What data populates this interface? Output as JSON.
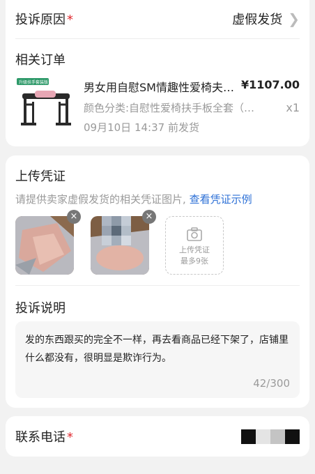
{
  "complaint_reason": {
    "label": "投诉原因",
    "required_mark": "*",
    "value": "虚假发货"
  },
  "related_order": {
    "title": "相关订单",
    "thumb_tag": "升级扶手套装版",
    "product_title": "男女用自慰SM情趣性爱椅夫…",
    "price": "¥1107.00",
    "spec": "颜色分类:自慰性爱椅扶手板全套（…",
    "quantity": "x1",
    "ship_time": "09月10日 14:37 前发货"
  },
  "upload": {
    "title": "上传凭证",
    "hint": "请提供卖家虚假发货的相关凭证图片,",
    "example_link": "查看凭证示例",
    "add_label": "上传凭证",
    "add_limit": "最多9张",
    "remove_symbol": "×"
  },
  "description": {
    "title": "投诉说明",
    "text": "发的东西跟买的完全不一样，再去看商品已经下架了，店铺里什么都没有，很明显是欺诈行为。",
    "count": "42/300"
  },
  "contact": {
    "label": "联系电话",
    "required_mark": "*"
  },
  "colors": {
    "required": "#e0292f",
    "link": "#2b6fd6",
    "muted": "#9a9a9a",
    "background": "#f2f2f2"
  }
}
